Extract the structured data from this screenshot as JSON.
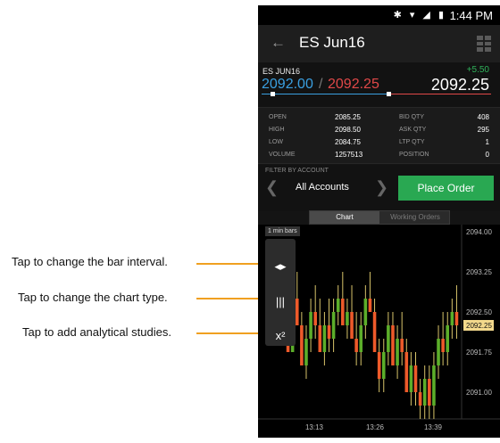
{
  "annotations": [
    {
      "text": "Tap to change the bar interval."
    },
    {
      "text": "Tap to change the chart type."
    },
    {
      "text": "Tap to add analytical studies."
    }
  ],
  "status_bar": {
    "time": "1:44 PM",
    "icons": "✱ ▾ ◢ ▮"
  },
  "app_bar": {
    "back_icon": "←",
    "title": "ES Jun16"
  },
  "quote": {
    "symbol": "ES JUN16",
    "change": "+5.50",
    "bid": "2092.00",
    "separator": "/",
    "ask": "2092.25",
    "last": "2092.25",
    "colors": {
      "bid": "#3a9fe0",
      "ask": "#e04848",
      "change": "#2fb35a"
    }
  },
  "stats": [
    {
      "label1": "OPEN",
      "value1": "2085.25",
      "label2": "BID QTY",
      "value2": "408"
    },
    {
      "label1": "HIGH",
      "value1": "2098.50",
      "label2": "ASK QTY",
      "value2": "295"
    },
    {
      "label1": "LOW",
      "value1": "2084.75",
      "label2": "LTP QTY",
      "value2": "1"
    },
    {
      "label1": "VOLUME",
      "value1": "1257513",
      "label2": "POSITION",
      "value2": "0"
    }
  ],
  "filter": {
    "label": "FILTER BY ACCOUNT",
    "prev_icon": "❮",
    "account": "All Accounts",
    "next_icon": "❯",
    "place_order": "Place Order"
  },
  "tabs": [
    {
      "label": "Chart",
      "active": true
    },
    {
      "label": "Working Orders",
      "active": false
    }
  ],
  "chart": {
    "bar_interval": "1 min bars",
    "tools": [
      {
        "icon": "bar-interval-icon",
        "glyph": "◂▸"
      },
      {
        "icon": "chart-type-icon",
        "glyph": "|||"
      },
      {
        "icon": "studies-icon",
        "glyph": "x²"
      }
    ],
    "price_labels": [
      "2094.00",
      "2093.25",
      "2092.50",
      "2092.25",
      "2091.75",
      "2091.00"
    ],
    "highlight_price": "2092.25",
    "time_labels": [
      "13:13",
      "13:26",
      "13:39"
    ],
    "up_color": "#5cae2a",
    "down_color": "#ee5a2a"
  },
  "chart_data": {
    "type": "candlestick",
    "x_ticks": [
      "13:13",
      "13:26",
      "13:39"
    ],
    "y_ticks": [
      "2094.00",
      "2093.25",
      "2092.50",
      "2091.75",
      "2091.00"
    ],
    "ylim": [
      2090.5,
      2094.0
    ],
    "last_price": 2092.25,
    "candles": [
      [
        2092.25,
        2092.5,
        2091.75,
        2091.75
      ],
      [
        2091.75,
        2093.0,
        2091.75,
        2092.75
      ],
      [
        2092.75,
        2093.25,
        2092.25,
        2092.25
      ],
      [
        2092.25,
        2092.5,
        2091.5,
        2091.5
      ],
      [
        2091.5,
        2092.25,
        2091.25,
        2092.0
      ],
      [
        2092.0,
        2092.75,
        2091.75,
        2092.5
      ],
      [
        2092.5,
        2093.0,
        2092.0,
        2092.25
      ],
      [
        2092.25,
        2092.75,
        2091.75,
        2091.75
      ],
      [
        2091.75,
        2092.5,
        2091.5,
        2092.25
      ],
      [
        2092.25,
        2092.75,
        2091.75,
        2092.0
      ],
      [
        2092.0,
        2092.75,
        2091.75,
        2092.5
      ],
      [
        2092.5,
        2093.0,
        2092.25,
        2092.75
      ],
      [
        2092.75,
        2093.25,
        2092.25,
        2092.25
      ],
      [
        2092.25,
        2092.75,
        2092.0,
        2092.5
      ],
      [
        2092.5,
        2093.0,
        2092.0,
        2092.0
      ],
      [
        2092.0,
        2092.5,
        2091.5,
        2091.75
      ],
      [
        2091.75,
        2092.5,
        2091.5,
        2092.25
      ],
      [
        2092.25,
        2093.0,
        2092.0,
        2092.75
      ],
      [
        2092.75,
        2093.25,
        2092.5,
        2092.5
      ],
      [
        2092.5,
        2092.75,
        2091.75,
        2091.75
      ],
      [
        2091.75,
        2092.0,
        2091.0,
        2091.25
      ],
      [
        2091.25,
        2092.0,
        2091.0,
        2091.75
      ],
      [
        2091.75,
        2092.5,
        2091.5,
        2092.25
      ],
      [
        2092.25,
        2092.5,
        2091.5,
        2091.5
      ],
      [
        2091.5,
        2092.25,
        2091.25,
        2092.0
      ],
      [
        2092.0,
        2092.5,
        2091.5,
        2091.75
      ],
      [
        2091.75,
        2092.0,
        2091.0,
        2091.0
      ],
      [
        2091.0,
        2091.75,
        2090.75,
        2091.5
      ],
      [
        2091.5,
        2091.75,
        2090.75,
        2091.0
      ],
      [
        2091.0,
        2091.25,
        2090.5,
        2090.75
      ],
      [
        2090.75,
        2091.5,
        2090.5,
        2091.25
      ],
      [
        2091.25,
        2091.5,
        2090.5,
        2090.75
      ],
      [
        2090.75,
        2091.75,
        2090.5,
        2091.5
      ],
      [
        2091.5,
        2092.25,
        2091.25,
        2092.0
      ],
      [
        2092.0,
        2092.5,
        2091.5,
        2091.75
      ],
      [
        2091.75,
        2092.5,
        2091.5,
        2092.25
      ],
      [
        2092.25,
        2092.75,
        2092.0,
        2092.5
      ],
      [
        2092.5,
        2093.0,
        2092.0,
        2092.25
      ]
    ]
  }
}
